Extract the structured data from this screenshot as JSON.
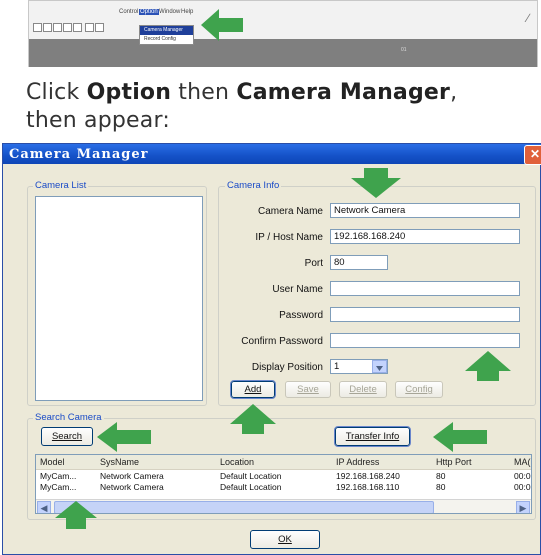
{
  "top_screenshot": {
    "menu": [
      "Control",
      "Option",
      "Window",
      "Help"
    ],
    "dropdown_items": [
      "Camera Manager",
      "Record Config"
    ],
    "status_number": "01"
  },
  "instruction": {
    "line1_pre": "Click ",
    "option": "Option",
    "line1_mid": " then ",
    "camera_manager": "Camera Manager",
    "line1_post": ",",
    "line2": "then appear:"
  },
  "dialog": {
    "title": "Camera Manager",
    "close_glyph": "✕",
    "camera_list_label": "Camera List",
    "camera_info": {
      "label": "Camera Info",
      "fields": [
        {
          "label": "Camera Name",
          "value": "Network Camera"
        },
        {
          "label": "IP / Host Name",
          "value": "192.168.168.240"
        },
        {
          "label": "Port",
          "value": "80"
        },
        {
          "label": "User Name",
          "value": ""
        },
        {
          "label": "Password",
          "value": ""
        },
        {
          "label": "Confirm Password",
          "value": ""
        },
        {
          "label": "Display Position",
          "value": "1"
        }
      ],
      "buttons": {
        "add": "Add",
        "save": "Save",
        "delete": "Delete",
        "config": "Config"
      }
    },
    "search_camera": {
      "label": "Search Camera",
      "search_button": "Search",
      "transfer_button": "Transfer Info",
      "columns": [
        "Model",
        "SysName",
        "Location",
        "IP Address",
        "Http Port",
        "MA("
      ],
      "rows": [
        [
          "MyCam...",
          "Network Camera",
          "Default Location",
          "192.168.168.240",
          "80",
          "00:0"
        ],
        [
          "MyCam...",
          "Network Camera",
          "Default Location",
          "192.168.168.110",
          "80",
          "00:0"
        ]
      ]
    },
    "ok_button": "OK"
  },
  "colors": {
    "titlebar": "#1451c7",
    "dialog_bg": "#ece9d8",
    "group_label": "#1a4bc7",
    "arrow_green": "#3fa34d"
  }
}
